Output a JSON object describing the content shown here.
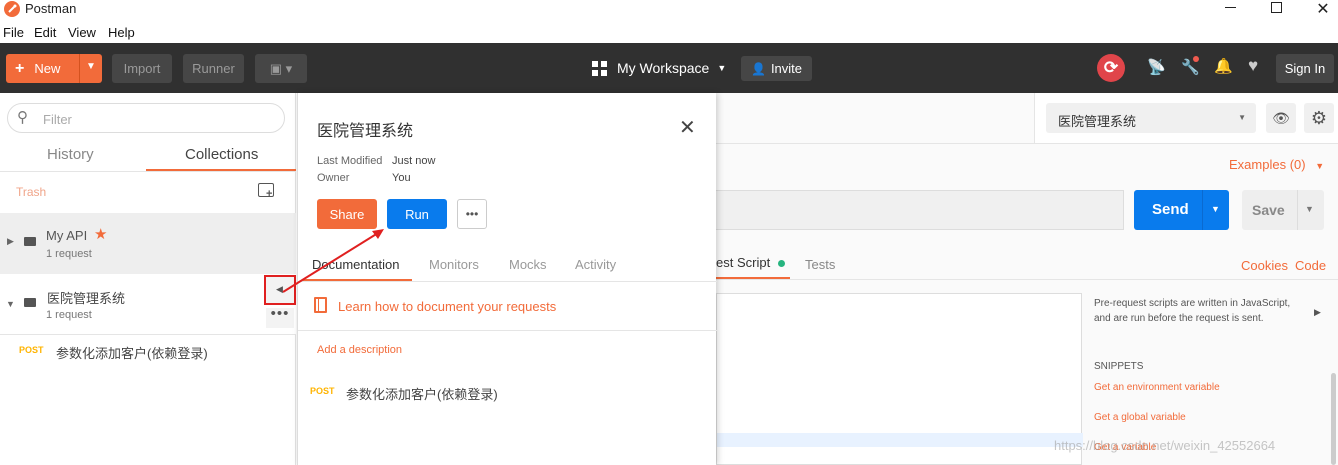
{
  "window": {
    "title": "Postman"
  },
  "menu": [
    "File",
    "Edit",
    "View",
    "Help"
  ],
  "toolbar": {
    "new_label": "New",
    "import_label": "Import",
    "runner_label": "Runner",
    "workspace_label": "My Workspace",
    "invite_label": "Invite",
    "signin_label": "Sign In"
  },
  "sidebar": {
    "filter_placeholder": "Filter",
    "tabs": [
      "History",
      "Collections"
    ],
    "trash_label": "Trash",
    "collections": [
      {
        "name": "My API",
        "meta": "1 request"
      },
      {
        "name": "医院管理系统",
        "meta": "1 request"
      }
    ],
    "requests": [
      {
        "method": "POST",
        "name": "参数化添加客户(依赖登录)"
      }
    ]
  },
  "panel": {
    "title": "医院管理系统",
    "last_modified_label": "Last Modified",
    "last_modified_value": "Just now",
    "owner_label": "Owner",
    "owner_value": "You",
    "share_label": "Share",
    "run_label": "Run",
    "tabs": [
      "Documentation",
      "Monitors",
      "Mocks",
      "Activity"
    ],
    "learn_link": "Learn how to document your requests",
    "add_description": "Add a description",
    "request_method": "POST",
    "request_name": "参数化添加客户(依赖登录)"
  },
  "main": {
    "environment": "医院管理系统",
    "examples_label": "Examples (0)",
    "send_label": "Send",
    "save_label": "Save",
    "tab_prerequest": "est Script",
    "tab_tests": "Tests",
    "cookies_label": "Cookies",
    "code_label": "Code",
    "help_text_1": "Pre-request scripts are written in JavaScript,",
    "help_text_2": "and are run before the request is sent.",
    "snippets_label": "SNIPPETS",
    "snippets": [
      "Get an environment variable",
      "Get a global variable",
      "Get a variable"
    ]
  },
  "watermark": "https://blog.csdn.net/weixin_42552664",
  "colors": {
    "accent": "#f26b3a",
    "blue": "#097bed",
    "dark": "#303030",
    "green": "#26b47f"
  }
}
